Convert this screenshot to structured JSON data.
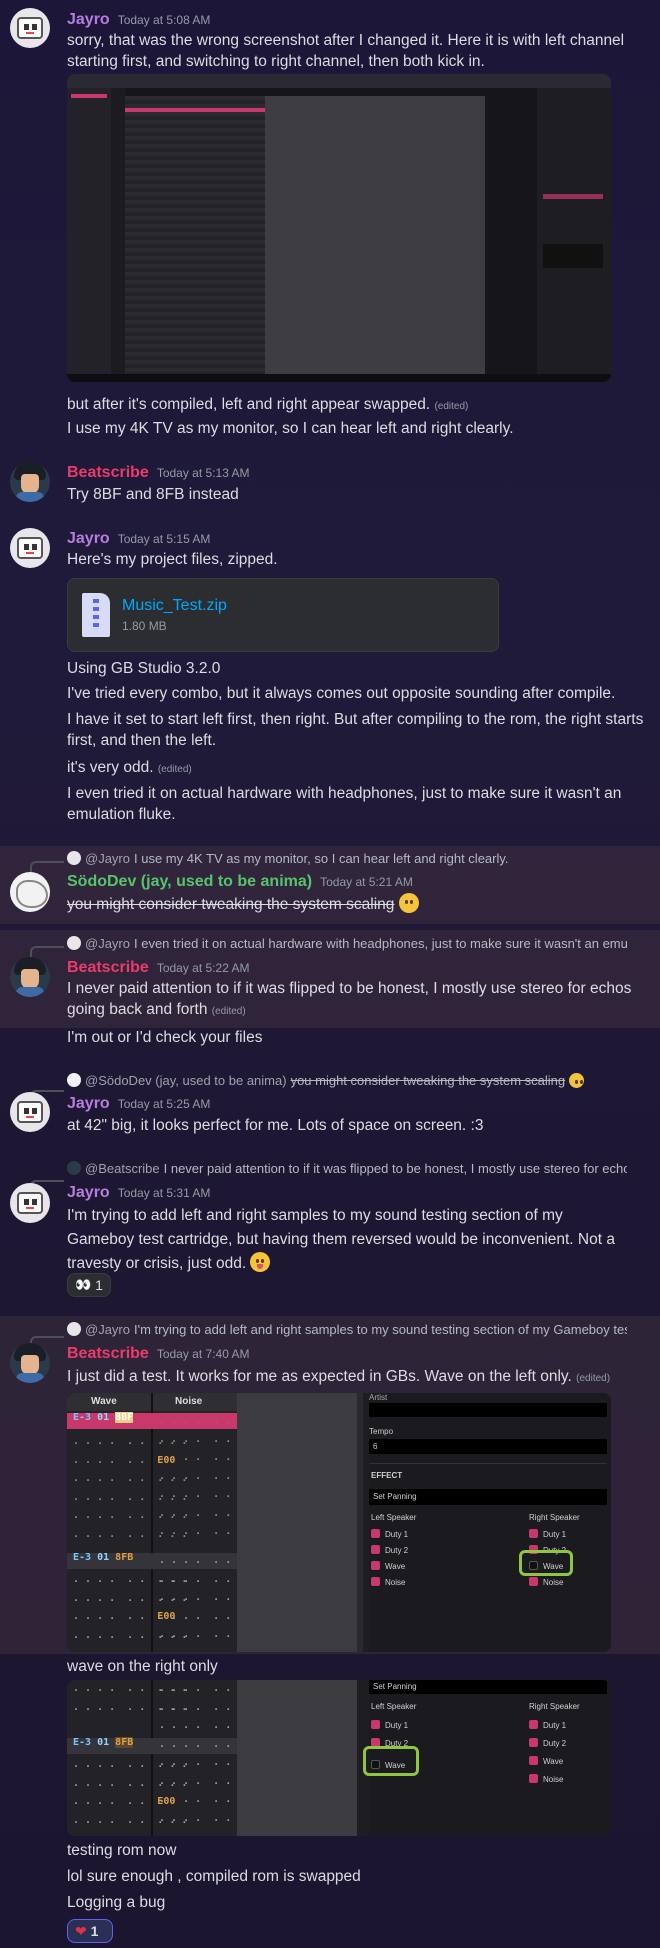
{
  "messages": [
    {
      "author": "Jayro",
      "time": "Today at 5:08 AM",
      "lines": [
        "sorry, that was the wrong screenshot after I changed it. Here it is with left channel starting first, and switching to right channel, then both kick in."
      ]
    },
    {
      "continuation": [
        "but after it's compiled, left and right appear swapped.",
        "I use my 4K TV as my monitor, so I can hear left and right clearly."
      ],
      "edited": "(edited)"
    },
    {
      "author": "Beatscribe",
      "time": "Today at 5:13 AM",
      "lines": [
        "Try 8BF and 8FB instead"
      ]
    },
    {
      "author": "Jayro",
      "time": "Today at 5:15 AM",
      "lines": [
        "Here's my project files, zipped."
      ],
      "attachment": {
        "name": "Music_Test.zip",
        "size": "1.80 MB"
      },
      "more": [
        "Using GB Studio 3.2.0",
        "I've tried every combo, but it always comes out opposite sounding after compile.",
        "I have it set to start left first, then right. But after compiling to the rom, the right starts first, and then the left.",
        "it's very odd.",
        "I even tried it on actual hardware with headphones, just to make sure it wasn't an emulation fluke."
      ]
    },
    {
      "reply": {
        "who": "@Jayro",
        "text": "I use my 4K TV as my monitor, so I can hear left and right clearly."
      },
      "author": "SödoDev (jay, used to be anima)",
      "time": "Today at 5:21 AM",
      "lines": [
        "you might consider tweaking the system scaling"
      ]
    },
    {
      "reply": {
        "who": "@Jayro",
        "text": "I even tried it on actual hardware with headphones, just to make sure it wasn't an emulation fluke."
      },
      "author": "Beatscribe",
      "time": "Today at 5:22 AM",
      "lines": [
        "I never paid attention to if it was flipped to be honest, I mostly use stereo for echos going back and forth",
        "I'm out or I'd check your files"
      ]
    },
    {
      "reply": {
        "who": "@SödoDev (jay, used to be anima)",
        "text": "you might consider tweaking the system scaling"
      },
      "author": "Jayro",
      "time": "Today at 5:25 AM",
      "lines": [
        "at 42\" big, it looks perfect for me. Lots of space on screen. :3"
      ]
    },
    {
      "reply": {
        "who": "@Beatscribe",
        "text": "I never paid attention to if it was flipped to be honest, I mostly use stereo for echos going back and forth"
      },
      "author": "Jayro",
      "time": "Today at 5:31 AM",
      "lines": [
        "I'm trying to add left and right samples to my sound testing section of my Gameboy test cartridge, but having them reversed would be inconvenient. Not a travesty or crisis, just odd."
      ],
      "reaction": {
        "emoji": "👀",
        "count": "1"
      }
    },
    {
      "reply": {
        "who": "@Jayro",
        "text": "I'm trying to add left and right samples to my sound testing section of my Gameboy test cartridge, but having them reversed would be inconvenient."
      },
      "author": "Beatscribe",
      "time": "Today at 7:40 AM",
      "lines": [
        "I just did a test. It works for me as expected in GBs. Wave on the left only."
      ],
      "more": [
        "wave on the right only",
        "testing rom now",
        "lol sure enough , compiled rom is swapped",
        "Logging a bug"
      ],
      "reaction": {
        "emoji": "❤",
        "count": "1"
      }
    }
  ],
  "edited_label": "(edited)",
  "tracker": {
    "col_wave": "Wave",
    "col_noise": "Noise",
    "rows_a": [
      ". . . .  . .  . . .",
      ". . . .  . .  E00",
      ". . . .  . .  . . .",
      ". . . .  . .  . . .",
      ". . . .  . .  . . .",
      ". . . .  . .  . . ."
    ],
    "note_first": "E-3",
    "inst": "01",
    "fx_bf": "8BF",
    "fx_fb": "8FB",
    "e00": "E00",
    "artist": "Artist",
    "tempo": "Tempo",
    "tempo_val": "6",
    "effect": "EFFECT",
    "set_panning": "Set Panning",
    "left_speaker": "Left Speaker",
    "right_speaker": "Right Speaker",
    "duty1": "Duty 1",
    "duty2": "Duty 2",
    "wave": "Wave",
    "noise": "Noise"
  },
  "colors": {
    "jayro": "#b57edc",
    "beatscribe": "#eb3b6a",
    "sodo": "#57c46b",
    "link": "#00a8fc",
    "highlight_box": "#8ec63f"
  }
}
